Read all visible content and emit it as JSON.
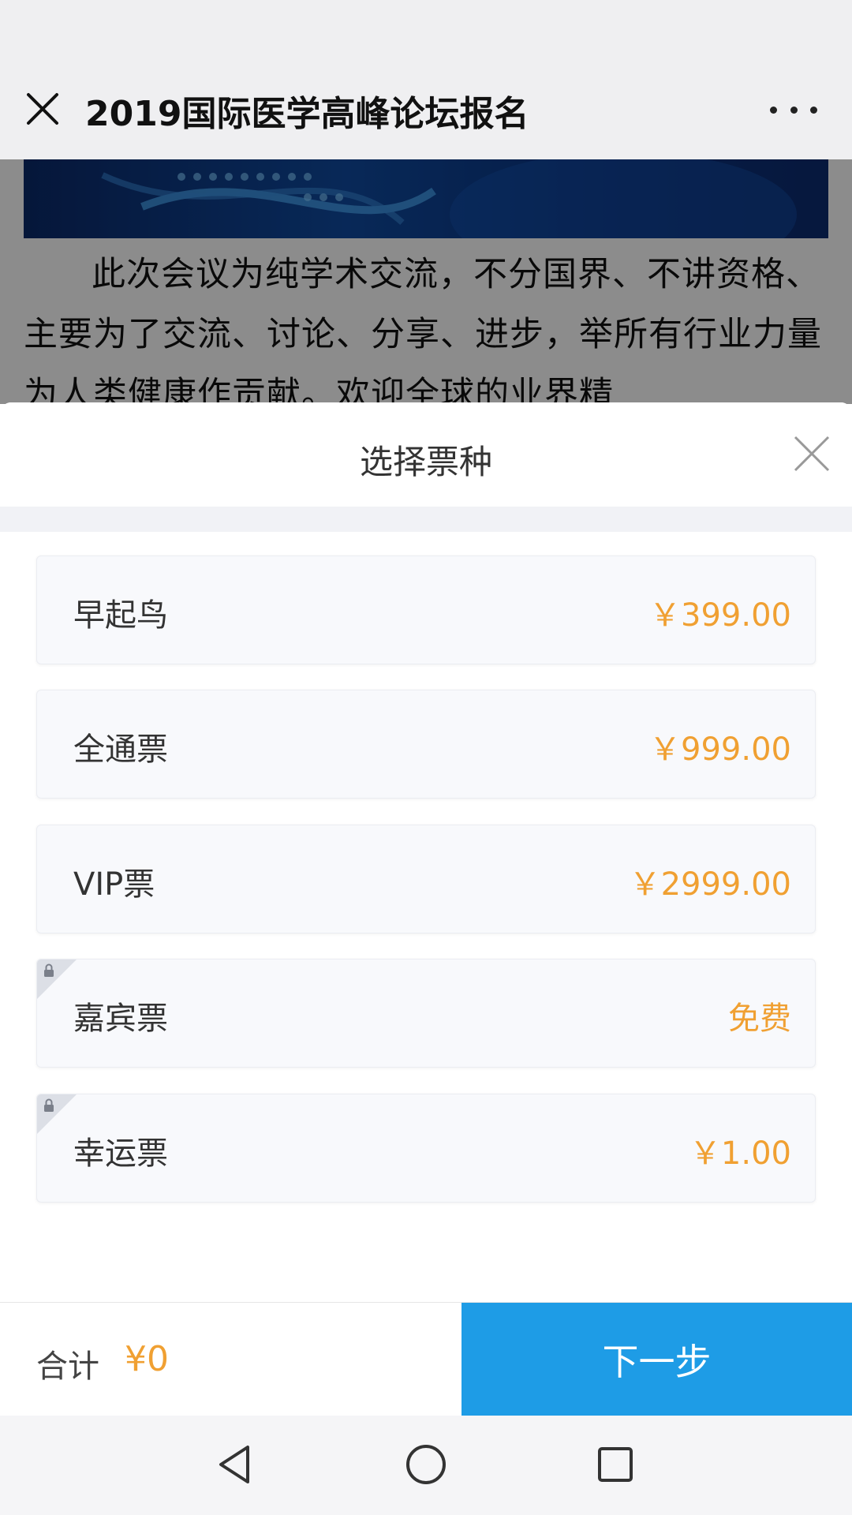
{
  "window": {
    "title": "2019国际医学高峰论坛报名",
    "close_icon": "close-icon",
    "more_icon": "more-dots-icon"
  },
  "article": {
    "text": "此次会议为纯学术交流，不分国界、不讲资格、主要为了交流、讨论、分享、进步，举所有行业力量为人类健康作贡献。欢迎全球的业界精"
  },
  "sheet": {
    "title": "选择票种",
    "close_icon": "close-icon"
  },
  "tickets": [
    {
      "name": "早起鸟",
      "price": "￥399.00",
      "locked": false
    },
    {
      "name": "全通票",
      "price": "￥999.00",
      "locked": false
    },
    {
      "name": "VIP票",
      "price": "￥2999.00",
      "locked": false
    },
    {
      "name": "嘉宾票",
      "price": "免费",
      "locked": true
    },
    {
      "name": "幸运票",
      "price": "￥1.00",
      "locked": true
    }
  ],
  "footer": {
    "total_label": "合计",
    "total_value": "¥0",
    "next_label": "下一步"
  },
  "colors": {
    "accent": "#1e9ce6",
    "price": "#f0a032"
  },
  "navbar": {
    "icons": [
      "back-triangle-icon",
      "home-circle-icon",
      "recents-square-icon"
    ]
  }
}
